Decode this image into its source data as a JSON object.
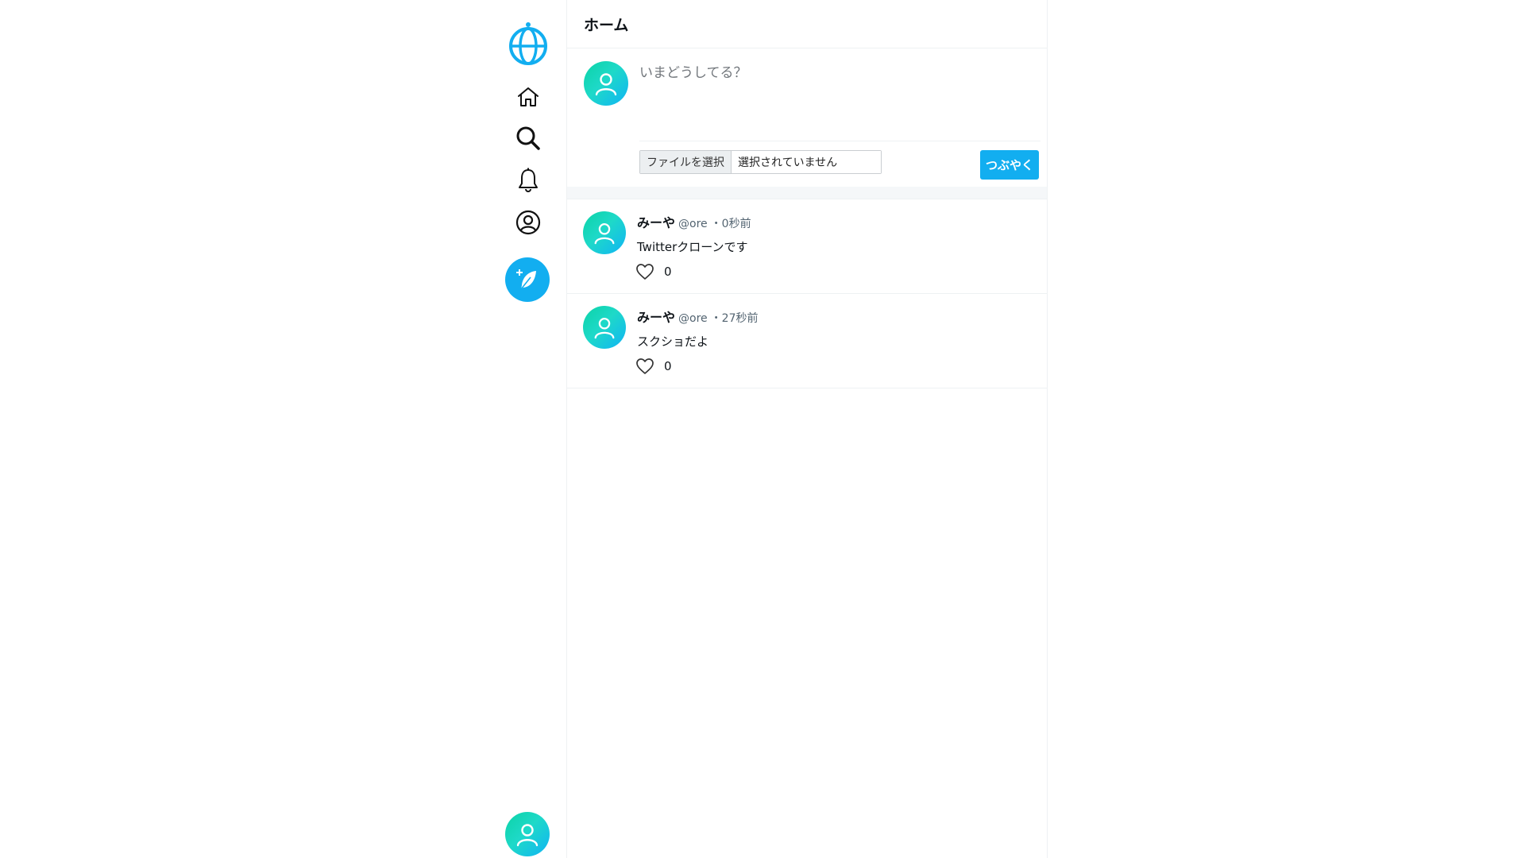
{
  "header": {
    "title": "ホーム"
  },
  "composer": {
    "placeholder": "いまどうしてる？",
    "file_button_label": "ファイルを選択",
    "file_status": "選択されていません",
    "submit_label": "つぶやく"
  },
  "tweets": [
    {
      "name": "みーや",
      "handle": "@ore",
      "time": "・0秒前",
      "text": "Twitterクローンです",
      "likes": "0"
    },
    {
      "name": "みーや",
      "handle": "@ore",
      "time": "・27秒前",
      "text": "スクショだよ",
      "likes": "0"
    }
  ],
  "sidebar": {
    "icons": [
      "globe-logo-icon",
      "home-icon",
      "search-icon",
      "bell-icon",
      "profile-icon",
      "compose-feather-icon",
      "account-avatar"
    ]
  },
  "colors": {
    "accent": "#12aef0",
    "avatar_from": "#0bd3a6",
    "avatar_to": "#10b4f5"
  }
}
